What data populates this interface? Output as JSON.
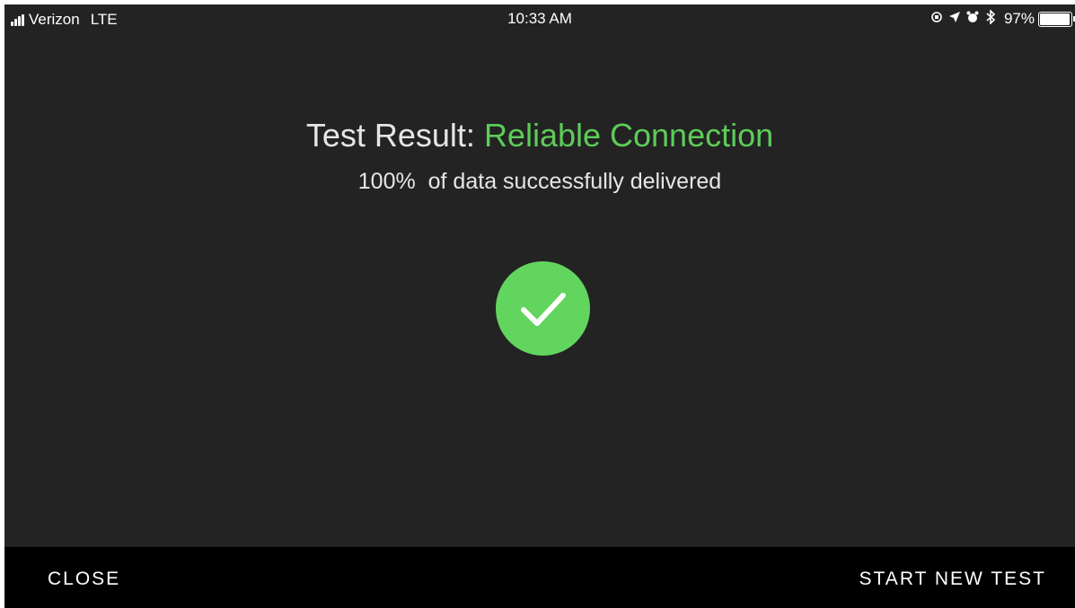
{
  "status_bar": {
    "carrier": "Verizon",
    "network": "LTE",
    "time": "10:33 AM",
    "battery": "97%",
    "battery_level": 0.97
  },
  "result": {
    "label": "Test Result:",
    "status": "Reliable Connection",
    "status_color": "#5dcc58",
    "percent": "100%",
    "detail": "of data successfully delivered"
  },
  "actions": {
    "close": "CLOSE",
    "start_new_test": "START NEW TEST"
  }
}
